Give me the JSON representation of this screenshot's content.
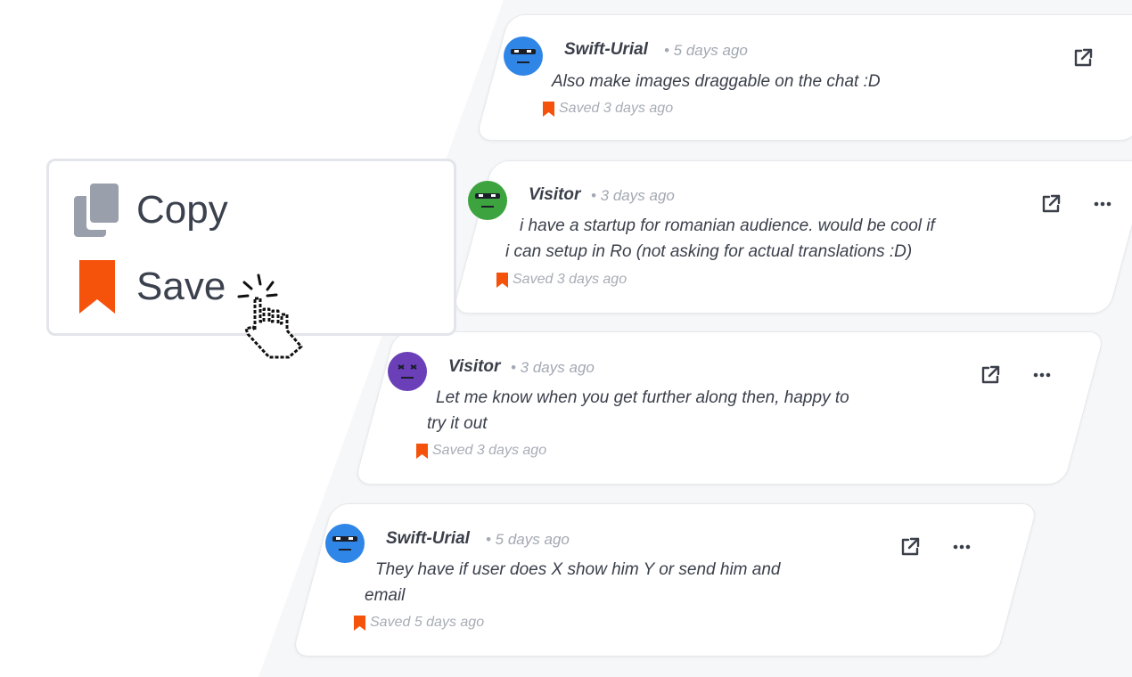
{
  "comments": [
    {
      "author": "Swift-Urial",
      "time": "• 5 days ago",
      "text_lines": [
        "Also make images draggable on the chat :D"
      ],
      "saved": "Saved 3 days ago",
      "avatar_color": "#2f86e6"
    },
    {
      "author": "Visitor",
      "time": "• 3 days ago",
      "text_lines": [
        "i have a startup for romanian audience. would be cool if",
        "i can setup in Ro (not asking for actual translations :D)"
      ],
      "saved": "Saved 3 days ago",
      "avatar_color": "#3da33f"
    },
    {
      "author": "Visitor",
      "time": "• 3 days ago",
      "text_lines": [
        "Let me know when you get further along then, happy to",
        "try it out"
      ],
      "saved": "Saved 3 days ago",
      "avatar_color": "#6a3fb8"
    },
    {
      "author": "Swift-Urial",
      "time": "• 5 days ago",
      "text_lines": [
        "They have if user does X show him Y or send him and",
        "email"
      ],
      "saved": "Saved 5 days ago",
      "avatar_color": "#2f86e6"
    }
  ],
  "context_menu": {
    "copy_label": "Copy",
    "save_label": "Save"
  },
  "colors": {
    "saved_accent": "#f5520c",
    "icon_gray": "#9aa0ab",
    "text_dark": "#3a3f4a"
  },
  "icons": {
    "copy": "copy-icon",
    "save": "bookmark-icon",
    "external": "external-link-icon",
    "more": "more-horizontal-icon",
    "cursor": "hand-pointer-icon"
  }
}
